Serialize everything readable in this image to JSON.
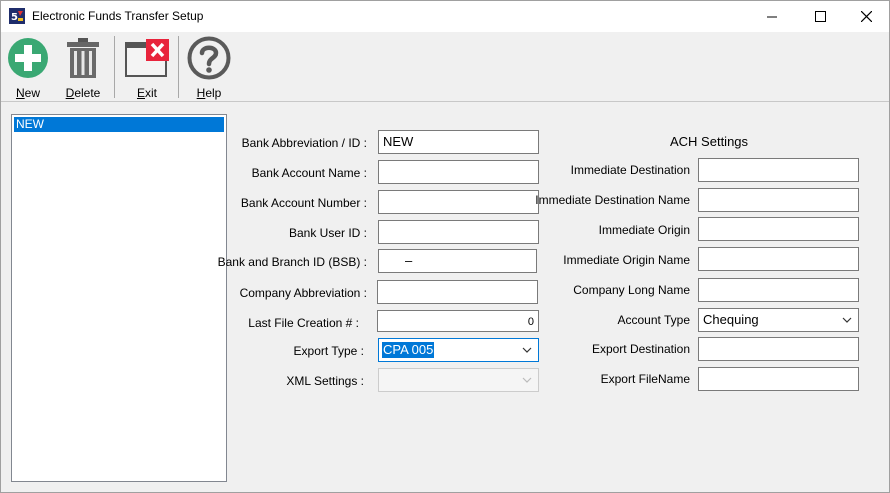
{
  "window": {
    "title": "Electronic Funds Transfer Setup",
    "app_icon": "app-logo-icon",
    "controls": [
      "minimize-icon",
      "maximize-icon",
      "close-icon"
    ]
  },
  "toolbar": {
    "new": {
      "mnemonic": "N",
      "rest": "ew",
      "icon": "plus-circle-icon"
    },
    "delete": {
      "mnemonic": "D",
      "rest": "elete",
      "icon": "trash-can-icon"
    },
    "exit": {
      "mnemonic": "E",
      "rest": "xit",
      "icon": "window-close-icon"
    },
    "help": {
      "mnemonic": "H",
      "rest": "elp",
      "icon": "question-circle-icon"
    }
  },
  "list": {
    "items": [
      "NEW"
    ]
  },
  "form": {
    "bank_abbrev": {
      "label": "Bank Abbreviation / ID :",
      "value": "NEW"
    },
    "bank_account_name": {
      "label": "Bank Account Name :",
      "value": ""
    },
    "bank_account_number": {
      "label": "Bank Account Number :",
      "value": ""
    },
    "bank_user_id": {
      "label": "Bank User ID :",
      "value": ""
    },
    "bsb": {
      "label": "Bank and Branch ID (BSB) :",
      "value": "–"
    },
    "company_abbrev": {
      "label": "Company Abbreviation :",
      "value": ""
    },
    "last_file": {
      "label": "Last File Creation # :",
      "value": "0"
    },
    "export_type": {
      "label": "Export Type :",
      "value": "CPA 005"
    },
    "xml_settings": {
      "label": "XML Settings :",
      "value": ""
    }
  },
  "ach": {
    "title": "ACH Settings",
    "immediate_destination": {
      "label": "Immediate Destination",
      "value": ""
    },
    "immediate_destination_name": {
      "label": "Immediate Destination Name",
      "value": ""
    },
    "immediate_origin": {
      "label": "Immediate Origin",
      "value": ""
    },
    "immediate_origin_name": {
      "label": "Immediate Origin Name",
      "value": ""
    },
    "company_long_name": {
      "label": "Company Long Name",
      "value": ""
    },
    "account_type": {
      "label": "Account Type",
      "value": "Chequing"
    },
    "export_destination": {
      "label": "Export Destination",
      "value": ""
    },
    "export_filename": {
      "label": "Export FileName",
      "value": ""
    }
  },
  "colors": {
    "selection": "#0078d7",
    "new_icon": "#3aa873",
    "exit_icon": "#e8243c"
  }
}
